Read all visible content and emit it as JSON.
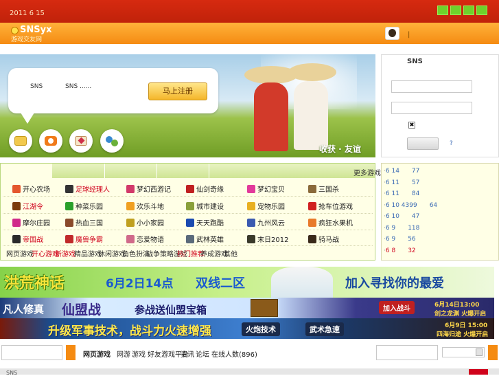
{
  "topbar": {
    "date": "2011 6 15"
  },
  "header": {
    "logo_main": "SNSyx",
    "logo_sub": "游戏交友网",
    "separator": "|"
  },
  "banner": {
    "intro_sns1": "SNS",
    "intro_sns2": "SNS    ......",
    "register_label": "马上注册",
    "slogan": "收获 · 友谊",
    "icons": [
      "chat-icon",
      "camera-icon",
      "mail-icon",
      "friends-icon"
    ]
  },
  "login": {
    "title": "SNS",
    "remember_mark": "✖",
    "help": "?"
  },
  "games": {
    "more": "更多游戏",
    "rows": [
      [
        {
          "label": "开心农场",
          "red": false,
          "icon": "#e4572e"
        },
        {
          "label": "足球经理人",
          "red": true,
          "icon": "#333333"
        },
        {
          "label": "梦幻西游记",
          "red": false,
          "icon": "#d23a6a"
        },
        {
          "label": "仙剑奇缘",
          "red": false,
          "icon": "#c02020"
        },
        {
          "label": "梦幻宝贝",
          "red": false,
          "icon": "#e23a9a"
        },
        {
          "label": "三国杀",
          "red": false,
          "icon": "#8a6a3a"
        }
      ],
      [
        {
          "label": "江湖令",
          "red": true,
          "icon": "#7a3a0a"
        },
        {
          "label": "种菜乐园",
          "red": false,
          "icon": "#2aa02a"
        },
        {
          "label": "欢乐斗地",
          "red": false,
          "icon": "#f0a020"
        },
        {
          "label": "城市建设",
          "red": false,
          "icon": "#8aa03a"
        },
        {
          "label": "宠物乐园",
          "red": false,
          "icon": "#e8b020"
        },
        {
          "label": "抢车位游戏",
          "red": false,
          "icon": "#d02020"
        }
      ],
      [
        {
          "label": "摩尔庄园",
          "red": false,
          "icon": "#d02a8a"
        },
        {
          "label": "热血三国",
          "red": false,
          "icon": "#8a4a2a"
        },
        {
          "label": "小小家园",
          "red": false,
          "icon": "#c0a020"
        },
        {
          "label": "天天跑酷",
          "red": false,
          "icon": "#1a4ab0"
        },
        {
          "label": "九州风云",
          "red": false,
          "icon": "#3a5ab0"
        },
        {
          "label": "疯狂水果机",
          "red": false,
          "icon": "#e87a2a"
        }
      ],
      [
        {
          "label": "帝国战",
          "red": true,
          "icon": "#2a2a2a"
        },
        {
          "label": "魔兽争霸",
          "red": true,
          "icon": "#c02a2a"
        },
        {
          "label": "恋爱物语",
          "red": false,
          "icon": "#d06a8a"
        },
        {
          "label": "武林英雄",
          "red": false,
          "icon": "#5a6a7a"
        },
        {
          "label": "末日2012",
          "red": false,
          "icon": "#3a3a2a"
        },
        {
          "label": "骑马战",
          "red": false,
          "icon": "#3a2a1a"
        }
      ]
    ],
    "nav": [
      {
        "label": "网页游戏",
        "red": false
      },
      {
        "label": "开心游戏",
        "red": true
      },
      {
        "label": "新游戏",
        "red": true
      },
      {
        "label": "精品游戏",
        "red": false
      },
      {
        "label": "休闲游戏",
        "red": false
      },
      {
        "label": "角色扮演",
        "red": false
      },
      {
        "label": "战争策略游戏",
        "red": false
      },
      {
        "label": "热门推荐",
        "red": true
      },
      {
        "label": "养成游戏",
        "red": false
      },
      {
        "label": "其他",
        "red": false
      }
    ]
  },
  "news": [
    {
      "date": "6 14",
      "value": "77",
      "red": false
    },
    {
      "date": "6 11",
      "value": "57",
      "red": false
    },
    {
      "date": "6 11",
      "value": "84",
      "red": false
    },
    {
      "date": "6 10  4399",
      "value": "64",
      "red": false
    },
    {
      "date": "6 10",
      "value": "47",
      "red": false
    },
    {
      "date": "6 9",
      "value": "118",
      "red": false
    },
    {
      "date": "6 9",
      "value": "56",
      "red": false
    },
    {
      "date": "6 8",
      "value": "32",
      "red": true
    }
  ],
  "ads": {
    "ad1_title": "洪荒神话",
    "ad1_date": "6月2日14点",
    "ad1_server": "双线二区",
    "ad1_slogan": "加入寻找你的最爱",
    "ad2_title": "凡人修真",
    "ad2_game": "仙盟战",
    "ad2_text": "参战送仙盟宝箱",
    "ad2_join": "加入战斗",
    "ad2_time": "6月14日13:00",
    "ad2_server": "剑之龙渊  火爆开启",
    "ad3_text": "升级军事技术，战斗力火速增强",
    "ad3_tag1": "火炮技术",
    "ad3_tag2": "武术急速",
    "ad3_time": "6月9日  15:00",
    "ad3_server": "四海归途  火爆开启"
  },
  "bottom": {
    "links": [
      {
        "label": "网页游戏"
      },
      {
        "label": "网游"
      },
      {
        "label": "游戏"
      },
      {
        "label": "好友游戏平台"
      },
      {
        "label": "资讯"
      },
      {
        "label": "论坛"
      },
      {
        "label": "在线人数(896)"
      }
    ],
    "footer_text": "SNS"
  }
}
